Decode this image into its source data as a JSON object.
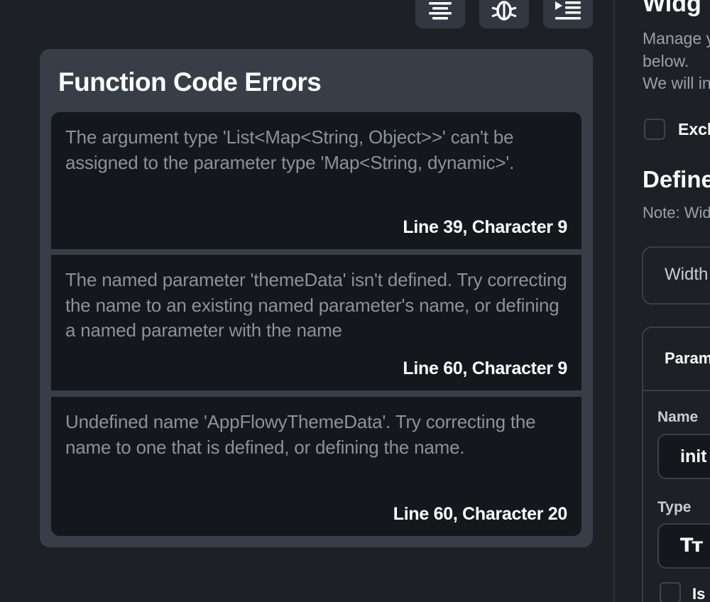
{
  "toolbar": {
    "buttons": [
      {
        "icon": "format-align-icon"
      },
      {
        "icon": "bug-icon"
      },
      {
        "icon": "indent-list-icon"
      }
    ]
  },
  "errors_panel": {
    "title": "Function Code Errors",
    "errors": [
      {
        "message": "The argument type 'List<Map<String, Object>>' can't be assigned to the parameter type 'Map<String, dynamic>'.",
        "location": "Line 39, Character 9"
      },
      {
        "message": "The named parameter 'themeData' isn't defined. Try correcting the name to an existing named parameter's name, or defining a named parameter with the name",
        "location": "Line 60, Character 9"
      },
      {
        "message": "Undefined name 'AppFlowyThemeData'. Try correcting the name to one that is defined, or defining the name.",
        "location": "Line 60, Character 20"
      }
    ]
  },
  "right_panel": {
    "title": "Widg",
    "description_lines": [
      "Manage y",
      "below.",
      "We will in"
    ],
    "exclude_label": "Excl",
    "define_title": "Define",
    "define_note": "Note: Wid",
    "width_label": "Width",
    "params_header": "Param",
    "name_label": "Name",
    "name_value": "init",
    "type_label": "Type",
    "type_icon_text": "Tт",
    "is_label": "Is"
  },
  "colors": {
    "background": "#1d2025",
    "panel": "#383e48",
    "error_card": "#14171b",
    "muted_text": "#8c929b"
  }
}
